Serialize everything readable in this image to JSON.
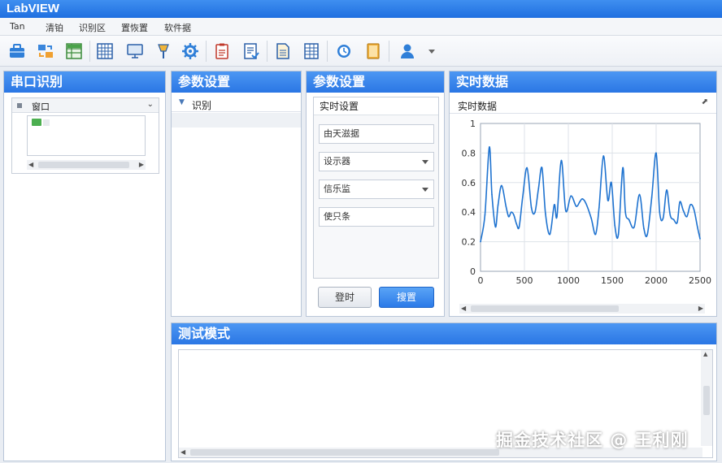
{
  "app": {
    "title": "LabVIEW"
  },
  "menu": [
    "Tan",
    "清铂",
    "识别区",
    "置恢置",
    "软件据"
  ],
  "toolbar": {
    "icons": [
      "toolbox-icon",
      "transfer-icon",
      "spreadsheet-icon",
      "grid-icon",
      "monitor-icon",
      "probe-icon",
      "gear-icon",
      "clipboard-icon",
      "document-check-icon",
      "report-icon",
      "table-icon",
      "clock-icon",
      "notebook-icon",
      "user-icon",
      "dropdown-arrow-icon"
    ]
  },
  "port_panel": {
    "title": "串口识别",
    "tree_header": "窗口"
  },
  "param_panel": {
    "title": "参数设置",
    "tree_item": "识别"
  },
  "settings_panel": {
    "title": "参数设置",
    "group_title": "实时设置",
    "field_1": "由天滋据",
    "select_1": "设示器",
    "select_2": "信乐监",
    "field_2": "使只条",
    "button_secondary": "登时",
    "button_primary": "搜置"
  },
  "realtime_panel": {
    "title": "实时数据",
    "subtitle": "实时数据"
  },
  "test_panel": {
    "title": "测试模式"
  },
  "watermark": "掘金技术社区 @ 王利刚",
  "colors": {
    "accent": "#2a76e4",
    "line": "#1f73d0"
  },
  "chart_data": {
    "type": "line",
    "title": "",
    "xlabel": "",
    "ylabel": "",
    "xlim": [
      0,
      2500
    ],
    "ylim": [
      0,
      1
    ],
    "x_ticks": [
      "0",
      "500",
      "1000",
      "1500",
      "2000",
      "2500"
    ],
    "y_ticks": [
      "0",
      "0.2",
      "0.4",
      "0.6",
      "0.8",
      "1"
    ],
    "grid": true,
    "series": [
      {
        "x": [
          0,
          50,
          100,
          130,
          170,
          200,
          240,
          290,
          320,
          350,
          380,
          410,
          440,
          480,
          530,
          580,
          620,
          660,
          700,
          740,
          790,
          840,
          870,
          920,
          970,
          1030,
          1090,
          1130,
          1160,
          1200,
          1260,
          1310,
          1350,
          1400,
          1450,
          1490,
          1530,
          1570,
          1620,
          1650,
          1690,
          1750,
          1810,
          1860,
          1900,
          1950,
          2000,
          2040,
          2080,
          2120,
          2160,
          2200,
          2240,
          2270,
          2310,
          2350,
          2390,
          2430,
          2470,
          2500
        ],
        "y": [
          0.2,
          0.38,
          0.84,
          0.52,
          0.3,
          0.45,
          0.58,
          0.44,
          0.37,
          0.4,
          0.38,
          0.32,
          0.3,
          0.5,
          0.7,
          0.43,
          0.4,
          0.56,
          0.7,
          0.39,
          0.25,
          0.45,
          0.37,
          0.75,
          0.41,
          0.51,
          0.44,
          0.47,
          0.49,
          0.46,
          0.36,
          0.25,
          0.43,
          0.78,
          0.48,
          0.6,
          0.31,
          0.25,
          0.7,
          0.4,
          0.35,
          0.3,
          0.52,
          0.29,
          0.25,
          0.5,
          0.8,
          0.4,
          0.36,
          0.55,
          0.38,
          0.35,
          0.33,
          0.47,
          0.41,
          0.37,
          0.45,
          0.42,
          0.3,
          0.22
        ]
      }
    ]
  }
}
